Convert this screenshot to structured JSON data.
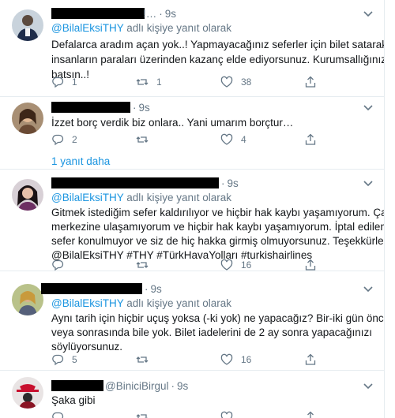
{
  "tweets": [
    {
      "name_tail": "!…",
      "time": "9s",
      "reply_prefix": "@BilalEksiTHY",
      "reply_suffix": "adlı kişiye yanıt olarak",
      "lines": [
        "Defalarca aradım açan yok..! Yapmayacağınız seferler için bilet satarak",
        "insanların paraları üzerinden kazanç elde ediyorsunuz. Kurumsallığınız",
        "batsın..!"
      ],
      "reply_count": "1",
      "retweet_count": "1",
      "like_count": "38"
    },
    {
      "time": "9s",
      "lines": [
        "İzzet borç verdik biz onlara.. Yani umarım borçtur…"
      ],
      "reply_count": "2",
      "retweet_count": "",
      "like_count": "4"
    },
    {
      "time": "9s",
      "reply_prefix": "@BilalEksiTHY",
      "reply_suffix": "adlı kişiye yanıt olarak",
      "lines": [
        "Gitmek istediğim sefer kaldırılıyor ve hiçbir hak kaybı yaşamıyorum. Çağrı",
        "merkezine ulaşamıyorum ve hiçbir hak kaybı yaşamıyorum. İptal edilen tarihe",
        "sefer konulmuyor ve siz de hiç hakka girmiş olmuyorsunuz. Teşekkürler."
      ],
      "hashtags": "@BilalEksiTHY #THY #TürkHavaYolları #turkishairlines",
      "reply_count": "",
      "retweet_count": "",
      "like_count": "16"
    },
    {
      "time": "9s",
      "reply_prefix": "@BilalEksiTHY",
      "reply_suffix": "adlı kişiye yanıt olarak",
      "lines": [
        "Aynı tarih için hiçbir uçuş yoksa (-ki yok) ne yapacağız? Bir-iki gün öncesinde",
        "veya sonrasında bile yok. Bilet iadelerini de 2 ay sonra yapacağınızı",
        "söylüyorsunuz."
      ],
      "reply_count": "5",
      "retweet_count": "",
      "like_count": "16"
    },
    {
      "handle": "@BiniciBirgul",
      "time": "9s",
      "lines": [
        "Şaka gibi"
      ],
      "reply_count": "",
      "retweet_count": "",
      "like_count": ""
    }
  ],
  "more_replies": "1 yanıt daha",
  "colors": {
    "link": "#1b95e0",
    "muted": "#657786",
    "text": "#14171a",
    "border": "#e6ecf0"
  }
}
